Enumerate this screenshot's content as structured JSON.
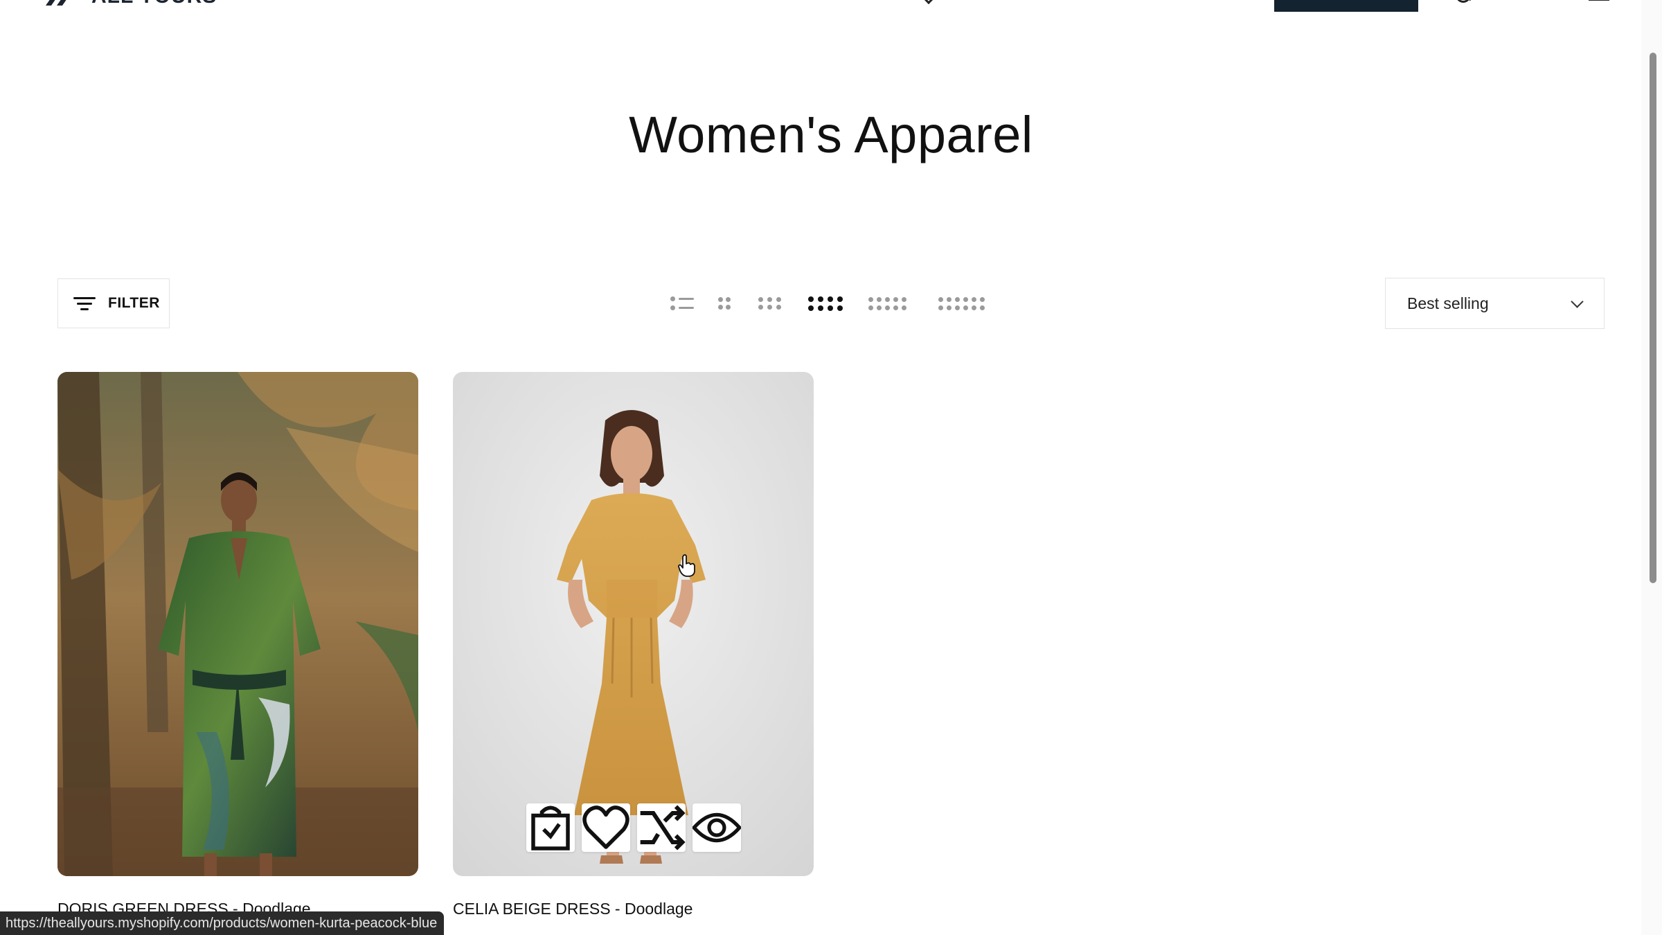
{
  "header": {
    "logo_text": "ALL YOURS",
    "icons": [
      "search-icon",
      "user-icon",
      "heart-icon",
      "cart-icon"
    ],
    "cta_color": "#13232f"
  },
  "page": {
    "title": "Women's Apparel"
  },
  "toolbar": {
    "filter_label": "FILTER",
    "view_options": [
      "list",
      "2-columns",
      "3-columns",
      "4-columns",
      "5-columns",
      "6-columns"
    ],
    "active_view": "4-columns",
    "sort_value": "Best selling"
  },
  "products": [
    {
      "name": "DORIS GREEN DRESS - Doodlage",
      "price": "",
      "image_colors": {
        "background": "#8a6a44",
        "dress": "#2e5a2a"
      }
    },
    {
      "name": "CELIA BEIGE DRESS - Doodlage",
      "price": "",
      "image_colors": {
        "background": "#e2e2e2",
        "dress": "#d6a14a"
      }
    }
  ],
  "quick_actions": [
    "add-to-cart-icon",
    "wishlist-heart-icon",
    "compare-shuffle-icon",
    "quick-view-eye-icon"
  ],
  "status_bar": {
    "url": "https://theallyours.myshopify.com/products/women-kurta-peacock-blue"
  }
}
